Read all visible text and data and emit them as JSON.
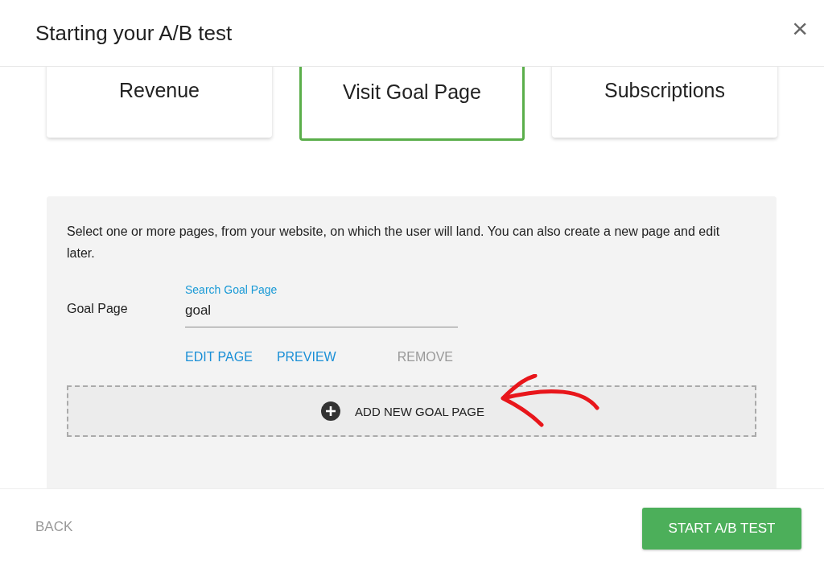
{
  "dialog": {
    "title": "Starting your A/B test",
    "close": "×"
  },
  "goal_types": [
    {
      "label": "Revenue",
      "selected": false
    },
    {
      "label": "Visit Goal Page",
      "selected": true
    },
    {
      "label": "Subscriptions",
      "selected": false
    }
  ],
  "panel": {
    "description": "Select one or more pages, from your website, on which the user will land. You can also create a new page and edit later.",
    "field_label": "Goal Page",
    "search": {
      "placeholder": "Search Goal Page",
      "value": "goal"
    },
    "actions": [
      {
        "label": "EDIT PAGE",
        "disabled": false
      },
      {
        "label": "PREVIEW",
        "disabled": false
      },
      {
        "label": "REMOVE",
        "disabled": true
      }
    ],
    "add_button": "ADD NEW GOAL PAGE"
  },
  "footer": {
    "back": "BACK",
    "start": "START A/B TEST"
  }
}
